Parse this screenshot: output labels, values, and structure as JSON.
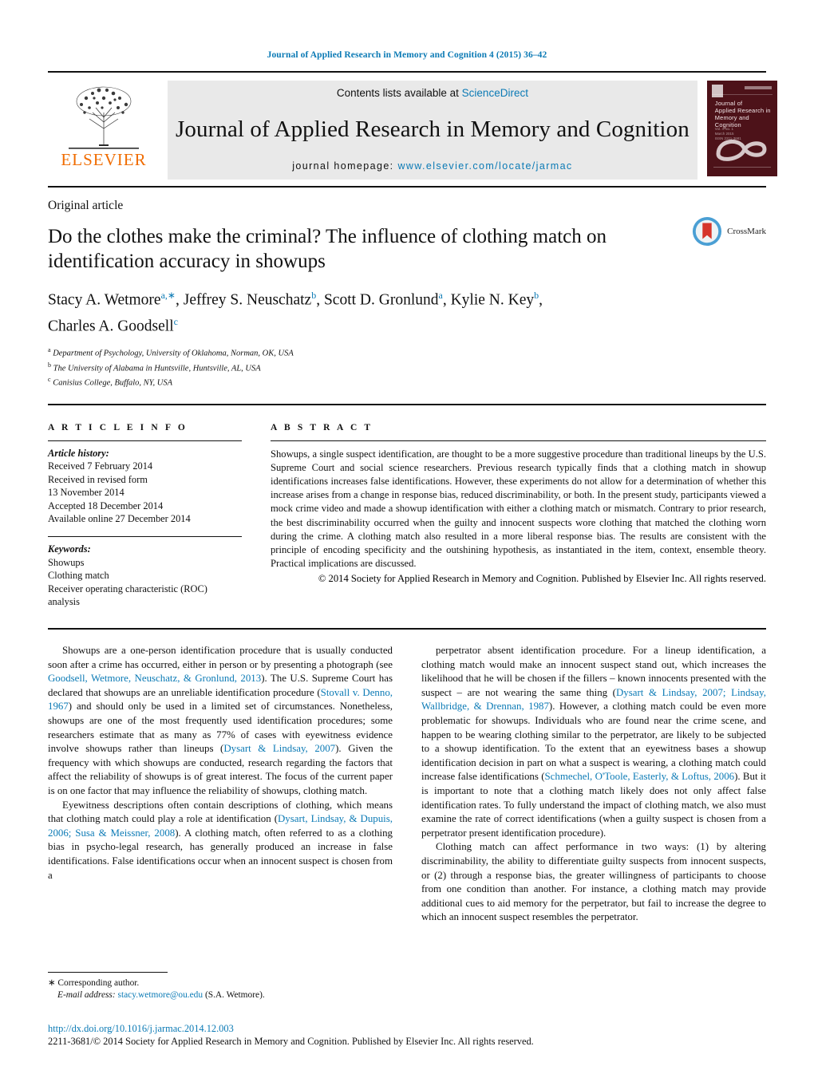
{
  "running_head": "Journal of Applied Research in Memory and Cognition 4 (2015) 36–42",
  "masthead": {
    "publisher_name": "ELSEVIER",
    "contents_prefix": "Contents lists available at ",
    "contents_link": "ScienceDirect",
    "journal_title": "Journal of Applied Research in Memory and Cognition",
    "homepage_prefix": "journal homepage: ",
    "homepage_url": "www.elsevier.com/locate/jarmac",
    "cover": {
      "title_lines": "Journal of\nApplied Research in\nMemory and Cognition"
    }
  },
  "article": {
    "type": "Original article",
    "title": "Do the clothes make the criminal? The influence of clothing match on identification accuracy in showups",
    "crossmark_label": "CrossMark",
    "authors_line1": "Stacy A. Wetmore",
    "authors_sup1": "a,∗",
    "authors_line2": ", Jeffrey S. Neuschatz",
    "authors_sup2": "b",
    "authors_line3": ", Scott D. Gronlund",
    "authors_sup3": "a",
    "authors_line4": ", Kylie N. Key",
    "authors_sup4": "b",
    "authors_line5": ",",
    "authors_line6": "Charles A. Goodsell",
    "authors_sup6": "c",
    "affiliations": [
      {
        "mark": "a",
        "text": "Department of Psychology, University of Oklahoma, Norman, OK, USA"
      },
      {
        "mark": "b",
        "text": "The University of Alabama in Huntsville, Huntsville, AL, USA"
      },
      {
        "mark": "c",
        "text": "Canisius College, Buffalo, NY, USA"
      }
    ]
  },
  "article_info": {
    "heading": "A R T I C L E   I N F O",
    "history_label": "Article history:",
    "history": [
      "Received 7 February 2014",
      "Received in revised form",
      "13 November 2014",
      "Accepted 18 December 2014",
      "Available online 27 December 2014"
    ],
    "keywords_label": "Keywords:",
    "keywords": [
      "Showups",
      "Clothing match",
      "Receiver operating characteristic (ROC)",
      "analysis"
    ]
  },
  "abstract": {
    "heading": "A B S T R A C T",
    "text": "Showups, a single suspect identification, are thought to be a more suggestive procedure than traditional lineups by the U.S. Supreme Court and social science researchers. Previous research typically finds that a clothing match in showup identifications increases false identifications. However, these experiments do not allow for a determination of whether this increase arises from a change in response bias, reduced discriminability, or both. In the present study, participants viewed a mock crime video and made a showup identification with either a clothing match or mismatch. Contrary to prior research, the best discriminability occurred when the guilty and innocent suspects wore clothing that matched the clothing worn during the crime. A clothing match also resulted in a more liberal response bias. The results are consistent with the principle of encoding specificity and the outshining hypothesis, as instantiated in the item, context, ensemble theory. Practical implications are discussed.",
    "copyright": "© 2014 Society for Applied Research in Memory and Cognition. Published by Elsevier Inc. All rights reserved."
  },
  "body": {
    "left_col": [
      {
        "segments": [
          {
            "t": "Showups are a one-person identification procedure that is usually conducted soon after a crime has occurred, either in person or by presenting a photograph (see ",
            "cite": false
          },
          {
            "t": "Goodsell, Wetmore, Neuschatz, & Gronlund, 2013",
            "cite": true
          },
          {
            "t": "). The U.S. Supreme Court has declared that showups are an unreliable identification procedure (",
            "cite": false
          },
          {
            "t": "Stovall v. Denno, 1967",
            "cite": true
          },
          {
            "t": ") and should only be used in a limited set of circumstances. Nonetheless, showups are one of the most frequently used identification procedures; some researchers estimate that as many as 77% of cases with eyewitness evidence involve showups rather than lineups (",
            "cite": false
          },
          {
            "t": "Dysart & Lindsay, 2007",
            "cite": true
          },
          {
            "t": "). Given the frequency with which showups are conducted, research regarding the factors that affect the reliability of showups is of great interest. The focus of the current paper is on one factor that may influence the reliability of showups, clothing match.",
            "cite": false
          }
        ]
      },
      {
        "segments": [
          {
            "t": "Eyewitness descriptions often contain descriptions of clothing, which means that clothing match could play a role at identification (",
            "cite": false
          },
          {
            "t": "Dysart, Lindsay, & Dupuis, 2006; Susa & Meissner, 2008",
            "cite": true
          },
          {
            "t": "). A clothing match, often referred to as a clothing bias in psycho-legal research, has generally produced an increase in false identifications. False identifications occur when an innocent suspect is chosen from a",
            "cite": false
          }
        ]
      }
    ],
    "right_col": [
      {
        "segments": [
          {
            "t": "perpetrator absent identification procedure. For a lineup identification, a clothing match would make an innocent suspect stand out, which increases the likelihood that he will be chosen if the fillers – known innocents presented with the suspect – are not wearing the same thing (",
            "cite": false
          },
          {
            "t": "Dysart & Lindsay, 2007; Lindsay, Wallbridge, & Drennan, 1987",
            "cite": true
          },
          {
            "t": "). However, a clothing match could be even more problematic for showups. Individuals who are found near the crime scene, and happen to be wearing clothing similar to the perpetrator, are likely to be subjected to a showup identification. To the extent that an eyewitness bases a showup identification decision in part on what a suspect is wearing, a clothing match could increase false identifications (",
            "cite": false
          },
          {
            "t": "Schmechel, O'Toole, Easterly, & Loftus, 2006",
            "cite": true
          },
          {
            "t": "). But it is important to note that a clothing match likely does not only affect false identification rates. To fully understand the impact of clothing match, we also must examine the rate of correct identifications (when a guilty suspect is chosen from a perpetrator present identification procedure).",
            "cite": false
          }
        ]
      },
      {
        "segments": [
          {
            "t": "Clothing match can affect performance in two ways: (1) by altering discriminability, the ability to differentiate guilty suspects from innocent suspects, or (2) through a response bias, the greater willingness of participants to choose from one condition than another. For instance, a clothing match may provide additional cues to aid memory for the perpetrator, but fail to increase the degree to which an innocent suspect resembles the perpetrator.",
            "cite": false
          }
        ]
      }
    ]
  },
  "footnote": {
    "star": "∗",
    "corresponding": "Corresponding author.",
    "email_label": "E-mail address:",
    "email": "stacy.wetmore@ou.edu",
    "email_owner": "(S.A. Wetmore)."
  },
  "footer": {
    "doi": "http://dx.doi.org/10.1016/j.jarmac.2014.12.003",
    "issn_line": "2211-3681/© 2014 Society for Applied Research in Memory and Cognition. Published by Elsevier Inc. All rights reserved."
  },
  "colors": {
    "link": "#0b7ab5",
    "elsevier_orange": "#f06c00",
    "banner_gray": "#e9e9e9",
    "cover_maroon": "#4d1219"
  }
}
